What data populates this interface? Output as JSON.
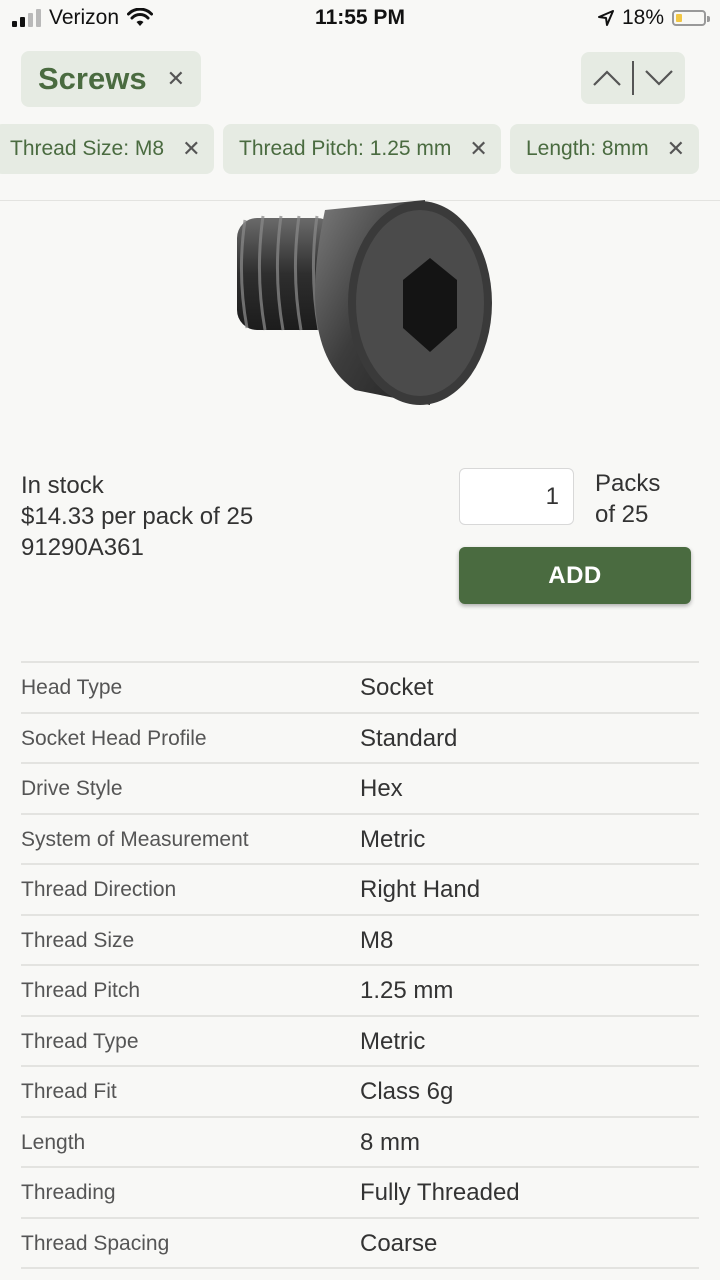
{
  "status_bar": {
    "carrier": "Verizon",
    "time": "11:55 PM",
    "battery": "18%",
    "battery_level": 0.18
  },
  "header": {
    "category": "Screws",
    "filters": [
      {
        "label": "Thread Size: M8"
      },
      {
        "label": "Thread Pitch: 1.25 mm"
      },
      {
        "label": "Length: 8mm"
      }
    ]
  },
  "purchase": {
    "stock": "In stock",
    "price": "$14.33 per pack of 25",
    "part_number": "91290A361",
    "quantity": "1",
    "pack_label_line1": "Packs",
    "pack_label_line2": "of 25",
    "add_label": "ADD"
  },
  "specs": [
    {
      "key": "Head Type",
      "value": "Socket"
    },
    {
      "key": "Socket Head Profile",
      "value": "Standard"
    },
    {
      "key": "Drive Style",
      "value": "Hex"
    },
    {
      "key": "System of Measurement",
      "value": "Metric"
    },
    {
      "key": "Thread Direction",
      "value": "Right Hand"
    },
    {
      "key": "Thread Size",
      "value": "M8"
    },
    {
      "key": "Thread Pitch",
      "value": "1.25 mm"
    },
    {
      "key": "Thread Type",
      "value": "Metric"
    },
    {
      "key": "Thread Fit",
      "value": "Class 6g"
    },
    {
      "key": "Length",
      "value": "8 mm"
    },
    {
      "key": "Threading",
      "value": "Fully Threaded"
    },
    {
      "key": "Thread Spacing",
      "value": "Coarse"
    }
  ],
  "colors": {
    "accent": "#4a6b40",
    "chip_bg": "#e6ebe3"
  }
}
